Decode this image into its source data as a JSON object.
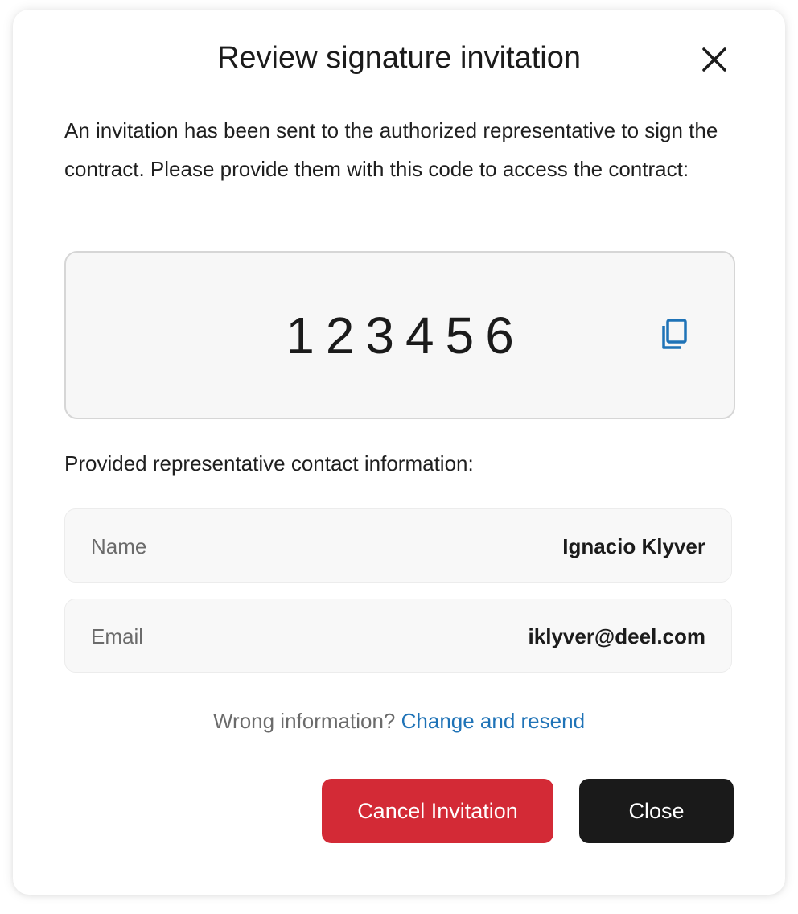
{
  "dialog": {
    "title": "Review signature invitation",
    "intro": "An invitation has been sent to the authorized representative to sign the contract. Please provide them with this code to access the contract:",
    "code": "123456",
    "section_label": "Provided representative contact information:",
    "contact": {
      "name_label": "Name",
      "name_value": "Ignacio Klyver",
      "email_label": "Email",
      "email_value": "iklyver@deel.com"
    },
    "wrong_info_text": "Wrong information?",
    "change_link": "Change and resend",
    "cancel_label": "Cancel Invitation",
    "close_label": "Close"
  },
  "icons": {
    "close": "close-icon",
    "copy": "copy-icon"
  },
  "colors": {
    "link": "#1f73b7",
    "danger": "#d32a36",
    "primary_dark": "#1a1a1a",
    "copy_icon": "#1f73b7"
  }
}
